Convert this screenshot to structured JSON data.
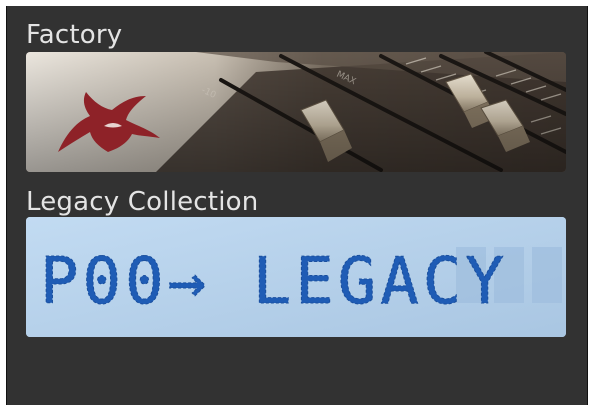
{
  "library": {
    "factory": {
      "title": "Factory",
      "icon": "swallow-bird-icon",
      "image": "fader-console-photo"
    },
    "legacy": {
      "title": "Legacy Collection",
      "lcd_text": "P00→ LEGACY"
    }
  },
  "colors": {
    "panel_bg": "#323232",
    "title_text": "#e4e4e4",
    "bird_red": "#8e2228",
    "lcd_bg": "#b8d2ea",
    "lcd_text": "#1f5cb5"
  }
}
